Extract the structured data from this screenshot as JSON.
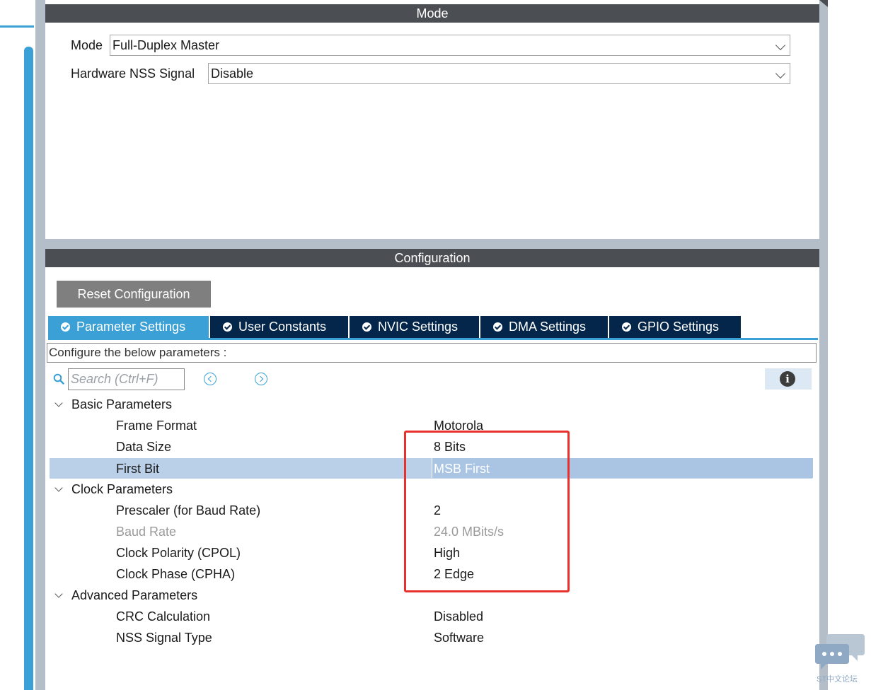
{
  "mode_panel": {
    "title": "Mode",
    "mode_label": "Mode",
    "mode_value": "Full-Duplex Master",
    "nss_label": "Hardware NSS Signal",
    "nss_value": "Disable"
  },
  "config_panel": {
    "title": "Configuration",
    "reset_label": "Reset Configuration",
    "tabs": [
      {
        "label": "Parameter Settings",
        "active": true
      },
      {
        "label": "User Constants",
        "active": false
      },
      {
        "label": "NVIC Settings",
        "active": false
      },
      {
        "label": "DMA Settings",
        "active": false
      },
      {
        "label": "GPIO Settings",
        "active": false
      }
    ],
    "describe": "Configure the below parameters :",
    "search_placeholder": "Search (Ctrl+F)",
    "groups": [
      {
        "label": "Basic Parameters",
        "params": [
          {
            "name": "Frame Format",
            "value": "Motorola"
          },
          {
            "name": "Data Size",
            "value": "8 Bits"
          },
          {
            "name": "First Bit",
            "value": "MSB First",
            "selected": true
          }
        ]
      },
      {
        "label": "Clock Parameters",
        "params": [
          {
            "name": "Prescaler (for Baud Rate)",
            "value": "2"
          },
          {
            "name": "Baud Rate",
            "value": "24.0 MBits/s",
            "disabled": true
          },
          {
            "name": "Clock Polarity (CPOL)",
            "value": "High"
          },
          {
            "name": "Clock Phase (CPHA)",
            "value": "2 Edge"
          }
        ]
      },
      {
        "label": "Advanced Parameters",
        "params": [
          {
            "name": "CRC Calculation",
            "value": "Disabled"
          },
          {
            "name": "NSS Signal Type",
            "value": "Software"
          }
        ]
      }
    ]
  },
  "watermark": {
    "text": "ST中文论坛"
  },
  "colors": {
    "accent": "#3aa0d6",
    "tab_dark": "#03264a",
    "header": "#4b4f53",
    "highlight": "#e8312c",
    "selected_row": "#b9d0e8"
  }
}
